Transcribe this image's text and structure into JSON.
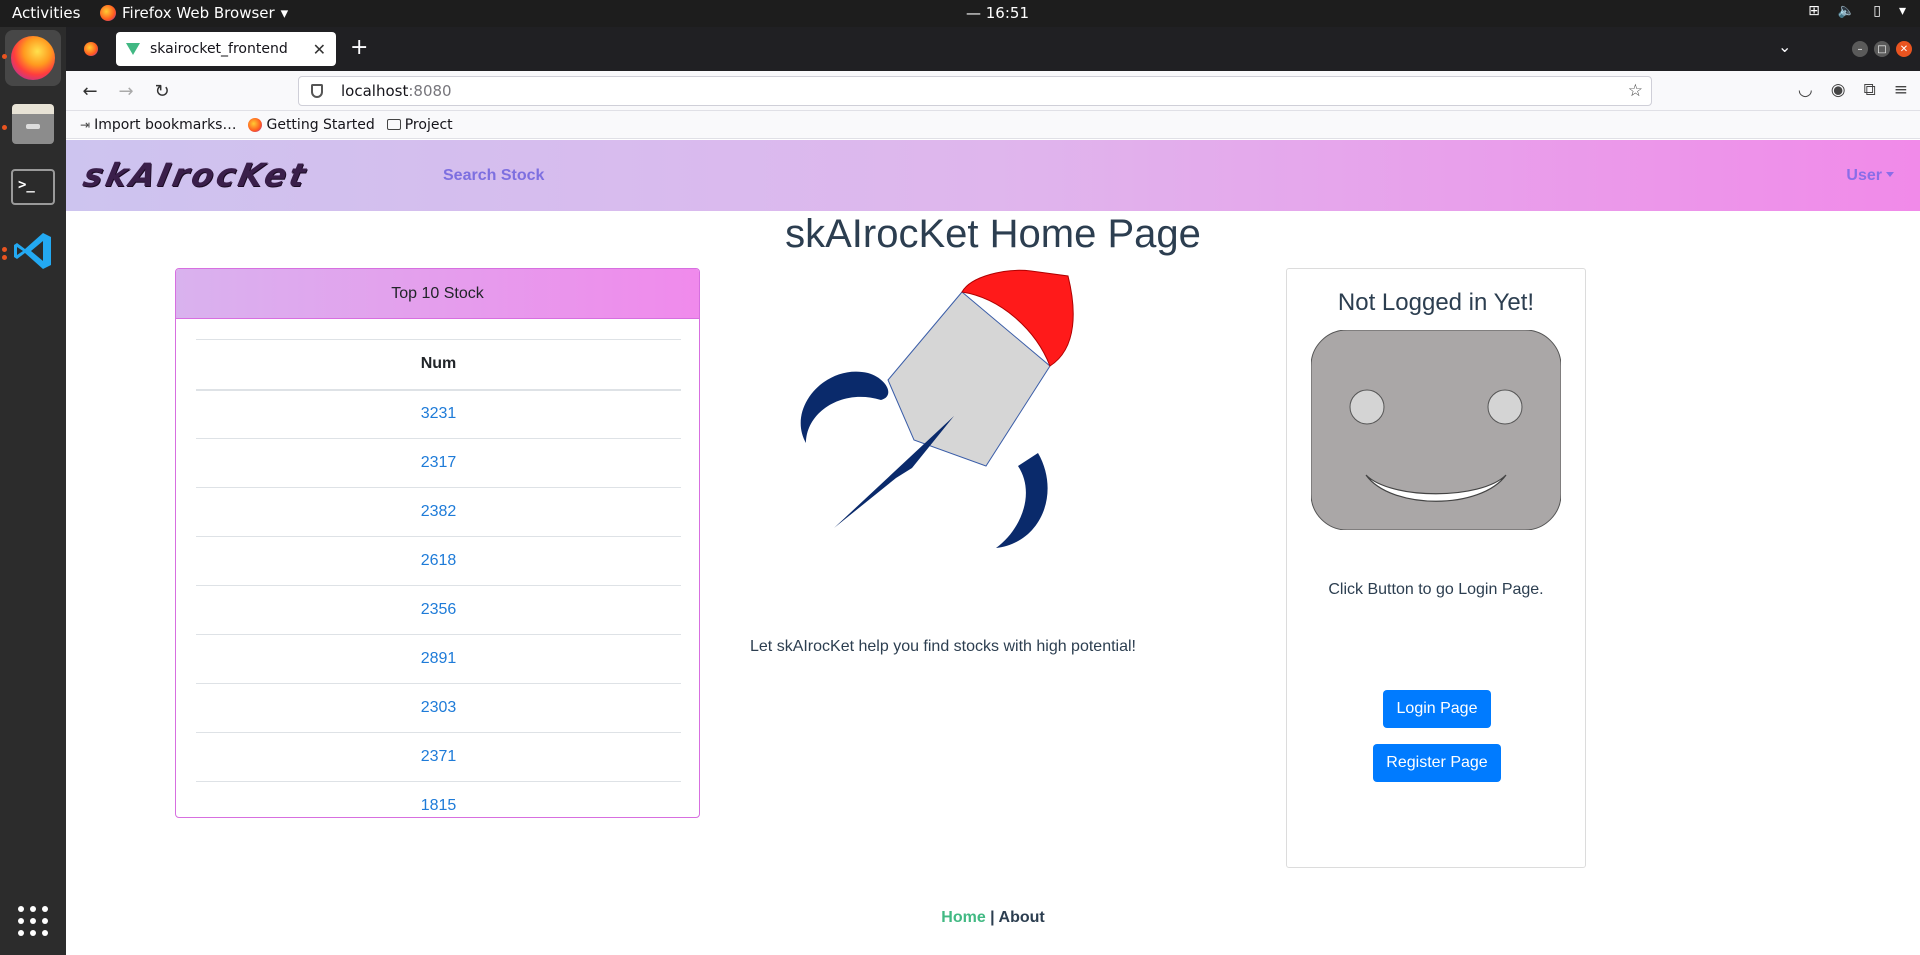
{
  "os": {
    "activities": "Activities",
    "app_name": "Firefox Web Browser",
    "clock": "— 16:51"
  },
  "browser": {
    "tab_title": "skairocket_frontend",
    "url_host": "localhost",
    "url_port": ":8080",
    "bookmarks": [
      "Import bookmarks…",
      "Getting Started",
      "Project"
    ]
  },
  "header": {
    "logo": "skAIrocKet",
    "search_link": "Search Stock",
    "user_menu": "User"
  },
  "page": {
    "title": "skAIrocKet Home Page",
    "tagline": "Let skAIrocKet help you find stocks with high potential!"
  },
  "stock_card": {
    "title": "Top 10 Stock",
    "column": "Num",
    "rows": [
      "3231",
      "2317",
      "2382",
      "2618",
      "2356",
      "2891",
      "2303",
      "2371",
      "1815"
    ]
  },
  "login_card": {
    "title": "Not Logged in Yet!",
    "message": "Click Button to go Login Page.",
    "login_button": "Login Page",
    "register_button": "Register Page"
  },
  "footer": {
    "home": "Home",
    "separator": " | ",
    "about": "About"
  },
  "colors": {
    "accent_blue": "#007bff",
    "link_blue": "#1e7bd8",
    "router_active": "#42b983",
    "rocket_body": "#d6d6d6",
    "rocket_nose": "#ff1a1a",
    "rocket_fins": "#0a2a6b"
  }
}
